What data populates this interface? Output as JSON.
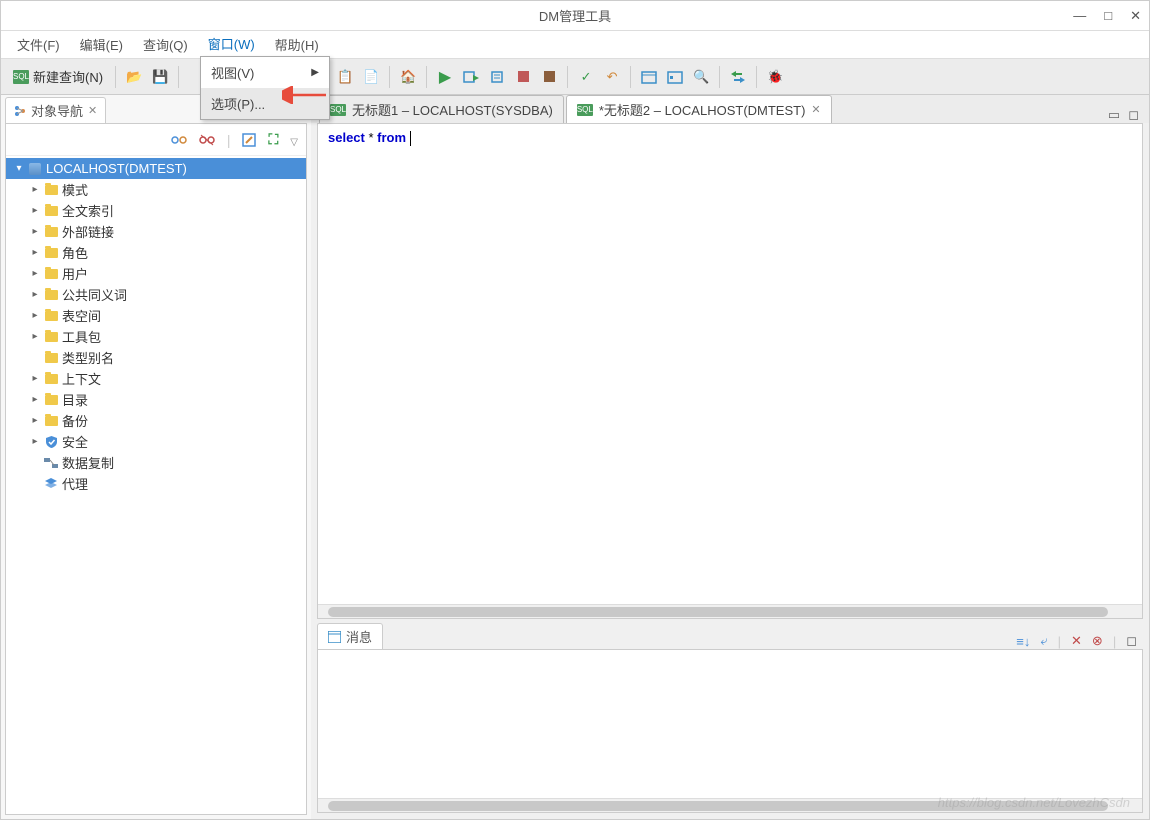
{
  "window": {
    "title": "DM管理工具"
  },
  "menubar": {
    "file": "文件(F)",
    "edit": "编辑(E)",
    "query": "查询(Q)",
    "window": "窗口(W)",
    "help": "帮助(H)"
  },
  "dropdown": {
    "view": "视图(V)",
    "options": "选项(P)..."
  },
  "toolbar": {
    "new_query_label": "新建查询(N)"
  },
  "left_panel": {
    "title": "对象导航",
    "root": "LOCALHOST(DMTEST)",
    "items": [
      "模式",
      "全文索引",
      "外部链接",
      "角色",
      "用户",
      "公共同义词",
      "表空间",
      "工具包",
      "类型别名",
      "上下文",
      "目录",
      "备份",
      "安全",
      "数据复制",
      "代理"
    ]
  },
  "editor": {
    "tab1": "无标题1 – LOCALHOST(SYSDBA)",
    "tab2": "*无标题2 – LOCALHOST(DMTEST)",
    "code_kw1": "select",
    "code_mid": " * ",
    "code_kw2": "from"
  },
  "messages": {
    "title": "消息"
  },
  "watermark": "https://blog.csdn.net/LovezhCsdn"
}
